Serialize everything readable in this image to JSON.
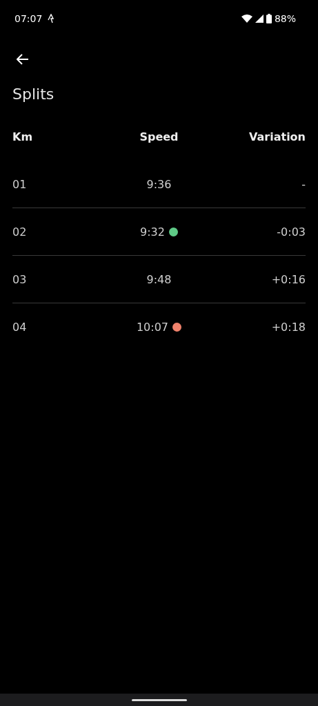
{
  "status_bar": {
    "time": "07:07",
    "battery": "88%"
  },
  "title": "Splits",
  "table": {
    "columns": [
      "Km",
      "Speed",
      "Variation"
    ],
    "rows": [
      {
        "km": "01",
        "speed": "9:36",
        "variation": "-"
      },
      {
        "km": "02",
        "speed": "9:32",
        "color": "#5fca87",
        "variation": "-0:03"
      },
      {
        "km": "03",
        "speed": "9:48",
        "variation": "+0:16"
      },
      {
        "km": "04",
        "speed": "10:07",
        "color": "#f0826c",
        "variation": "+0:18"
      }
    ]
  }
}
